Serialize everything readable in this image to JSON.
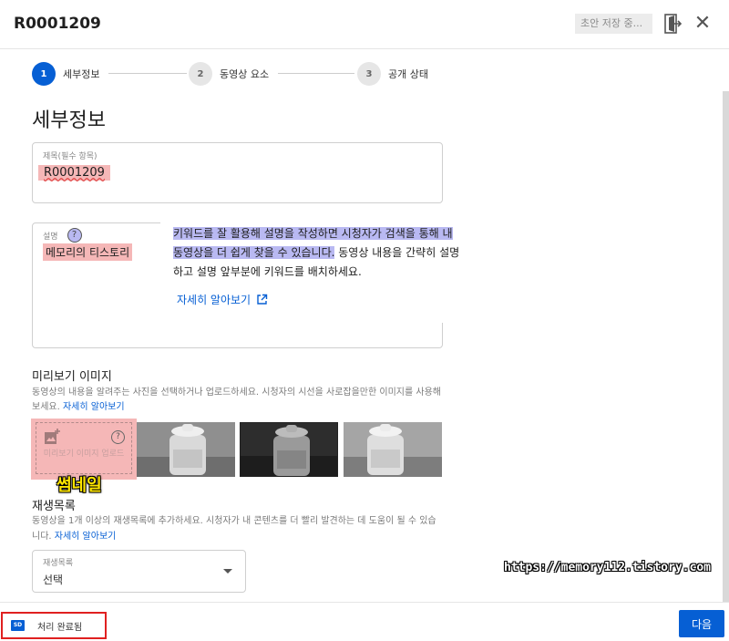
{
  "header": {
    "title": "R0001209",
    "save_status": "초안 저장 중...",
    "exit_icon": "exit-door-icon",
    "close_icon": "close-icon",
    "close_glyph": "✕"
  },
  "stepper": {
    "steps": [
      {
        "number": "1",
        "label": "세부정보",
        "state": "active"
      },
      {
        "number": "2",
        "label": "동영상 요소",
        "state": "inactive"
      },
      {
        "number": "3",
        "label": "공개 상태",
        "state": "inactive"
      }
    ]
  },
  "details": {
    "heading": "세부정보",
    "title_field": {
      "label": "제목(필수 항목)",
      "value": "R0001209"
    },
    "description_field": {
      "label": "설명",
      "help": "?",
      "value": "메모리의 티스토리"
    },
    "tooltip": {
      "line1": "키워드를 잘 활용해 설명을 작성하면 시청자가 검색을 통해 내",
      "line2_highlight": "동영상을 더 쉽게 찾을 수 있습니다.",
      "line2_rest": " 동영상 내용을 간략히 설명",
      "line3": "하고 설명 앞부분에 키워드를 배치하세요.",
      "link": "자세히 알아보기"
    }
  },
  "thumbnail": {
    "heading": "미리보기 이미지",
    "description": "동영상의 내용을 알려주는 사진을 선택하거나 업로드하세요. 시청자의 시선을 사로잡을만한 이미지를 사용해 보세요. ",
    "link": "자세히 알아보기",
    "upload_label": "미리보기 이미지 업로드",
    "upload_help": "?",
    "annotation": "썸네일",
    "options_count": 3
  },
  "playlist": {
    "heading": "재생목록",
    "description": "동영상을 1개 이상의 재생목록에 추가하세요. 시청자가 내 콘텐츠를 더 빨리 발견하는 데 도움이 될 수 있습니다. ",
    "link": "자세히 알아보기",
    "select_label": "재생목록",
    "select_value": "선택"
  },
  "watermark": "https://memory112.tistory.com",
  "footer": {
    "badge": "SD",
    "status": "처리 완료됨",
    "next_label": "다음"
  },
  "colors": {
    "accent": "#065fd4",
    "highlight_red": "#f5b7b7",
    "highlight_purple": "#b9b9f2",
    "annotation_yellow": "#ffe600",
    "box_red": "#e02020"
  }
}
